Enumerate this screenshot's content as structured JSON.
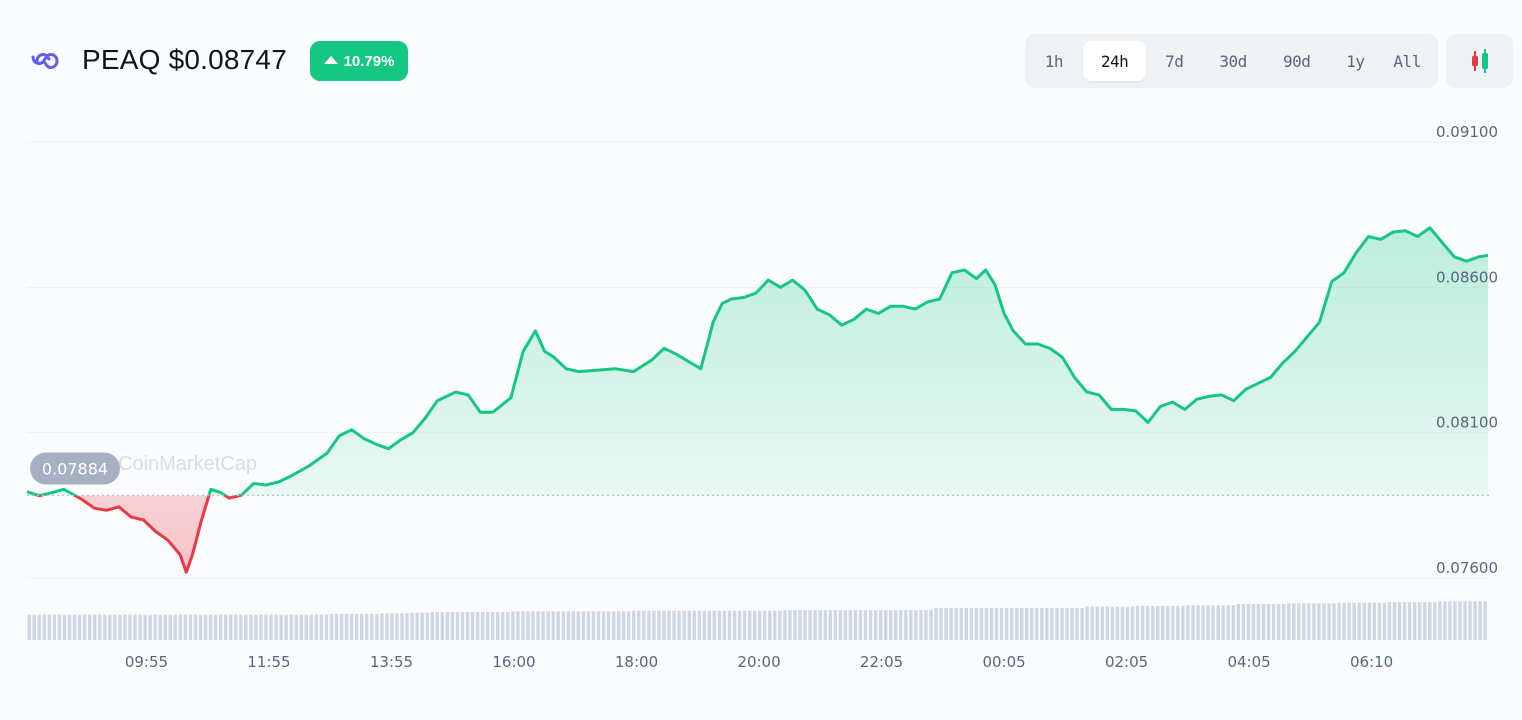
{
  "header": {
    "coin_title": "PEAQ $0.08747",
    "change": "10.79%",
    "logo_icon": "peaq-infinity-icon",
    "candle_icon": "candlestick-icon"
  },
  "tabs": [
    {
      "label": "1h",
      "active": false
    },
    {
      "label": "24h",
      "active": true
    },
    {
      "label": "7d",
      "active": false
    },
    {
      "label": "30d",
      "active": false
    },
    {
      "label": "90d",
      "active": false
    },
    {
      "label": "1y",
      "active": false
    },
    {
      "label": "All",
      "active": false
    }
  ],
  "watermark": "CoinMarketCap",
  "colors": {
    "up": "#16c784",
    "down": "#ea3943",
    "badge": "#16c784",
    "grid": "#eff2f5",
    "volume": "#cfd6e4",
    "ref_label_bg": "#a6b0c3"
  },
  "chart_data": {
    "type": "line",
    "title": "",
    "xlabel": "",
    "ylabel": "",
    "ylim": [
      0.0755,
      0.0915
    ],
    "yticks": [
      0.076,
      0.081,
      0.086,
      0.091
    ],
    "ytick_labels": [
      "0.07600",
      "0.08100",
      "0.08600",
      "0.09100"
    ],
    "reference_price": 0.07884,
    "reference_label": "0.07884",
    "grid": true,
    "xtick_labels": [
      "09:55",
      "11:55",
      "13:55",
      "16:00",
      "18:00",
      "20:00",
      "22:05",
      "00:05",
      "02:05",
      "04:05",
      "06:10"
    ],
    "xtick_positions": [
      1.95,
      3.95,
      5.95,
      7.95,
      9.95,
      11.95,
      13.95,
      15.95,
      17.95,
      19.95,
      21.95
    ],
    "x_hours_from_start": [
      0,
      0.2,
      0.4,
      0.6,
      0.9,
      1.1,
      1.3,
      1.5,
      1.7,
      1.9,
      2.1,
      2.3,
      2.5,
      2.6,
      2.7,
      2.85,
      3.0,
      3.15,
      3.3,
      3.5,
      3.7,
      3.9,
      4.1,
      4.3,
      4.6,
      4.9,
      5.1,
      5.3,
      5.5,
      5.7,
      5.9,
      6.1,
      6.3,
      6.5,
      6.7,
      7.0,
      7.2,
      7.4,
      7.6,
      7.9,
      8.1,
      8.3,
      8.45,
      8.6,
      8.8,
      9.0,
      9.3,
      9.6,
      9.9,
      10.2,
      10.4,
      10.6,
      10.8,
      11.0,
      11.2,
      11.35,
      11.5,
      11.7,
      11.9,
      12.1,
      12.3,
      12.5,
      12.7,
      12.9,
      13.1,
      13.3,
      13.5,
      13.7,
      13.9,
      14.1,
      14.3,
      14.5,
      14.7,
      14.9,
      15.1,
      15.3,
      15.5,
      15.65,
      15.8,
      15.95,
      16.1,
      16.3,
      16.5,
      16.7,
      16.9,
      17.1,
      17.3,
      17.5,
      17.7,
      17.9,
      18.1,
      18.3,
      18.5,
      18.7,
      18.9,
      19.1,
      19.3,
      19.5,
      19.7,
      19.9,
      20.1,
      20.3,
      20.5,
      20.7,
      20.9,
      21.1,
      21.3,
      21.5,
      21.7,
      21.9,
      22.1,
      22.3,
      22.5,
      22.7,
      22.9,
      23.1,
      23.3,
      23.5,
      23.7,
      23.85
    ],
    "series": [
      {
        "values": [
          0.07897,
          0.07883,
          0.07893,
          0.07905,
          0.0787,
          0.0784,
          0.07833,
          0.07845,
          0.0781,
          0.078,
          0.0776,
          0.0773,
          0.0768,
          0.0762,
          0.0768,
          0.078,
          0.07905,
          0.07895,
          0.07875,
          0.07885,
          0.07925,
          0.0792,
          0.0793,
          0.0795,
          0.07985,
          0.0803,
          0.0809,
          0.0811,
          0.0808,
          0.0806,
          0.08045,
          0.08075,
          0.081,
          0.0815,
          0.0821,
          0.0824,
          0.0823,
          0.0817,
          0.0817,
          0.0822,
          0.0838,
          0.0845,
          0.0838,
          0.0836,
          0.0832,
          0.0831,
          0.08315,
          0.0832,
          0.0831,
          0.0835,
          0.0839,
          0.0837,
          0.08345,
          0.0832,
          0.0848,
          0.08545,
          0.0856,
          0.08565,
          0.0858,
          0.08625,
          0.086,
          0.08625,
          0.0859,
          0.08525,
          0.08505,
          0.0847,
          0.0849,
          0.08525,
          0.0851,
          0.08535,
          0.08535,
          0.08525,
          0.0855,
          0.0856,
          0.0865,
          0.0866,
          0.0863,
          0.0866,
          0.0861,
          0.0851,
          0.0845,
          0.08405,
          0.08405,
          0.0839,
          0.0836,
          0.0829,
          0.0824,
          0.0823,
          0.0818,
          0.0818,
          0.08175,
          0.08135,
          0.0819,
          0.08205,
          0.0818,
          0.08215,
          0.08225,
          0.0823,
          0.0821,
          0.0825,
          0.0827,
          0.0829,
          0.0834,
          0.0838,
          0.0843,
          0.0848,
          0.0862,
          0.0865,
          0.0872,
          0.08775,
          0.08765,
          0.0879,
          0.08795,
          0.08775,
          0.08805,
          0.08755,
          0.08705,
          0.0869,
          0.08705,
          0.0871
        ]
      }
    ],
    "volume": [
      38,
      38,
      38,
      38,
      38,
      38,
      38,
      38,
      38,
      38,
      38,
      38,
      38,
      38,
      38,
      38,
      38,
      38,
      38,
      38,
      38,
      38,
      38,
      38,
      38,
      38,
      38,
      38,
      38,
      38,
      38,
      38,
      38,
      38,
      38,
      38,
      38,
      38,
      38,
      38,
      38,
      38,
      38,
      38,
      38,
      38,
      38,
      38,
      38,
      38,
      38,
      38,
      38,
      38,
      38,
      38,
      38,
      38,
      38,
      38,
      39,
      39,
      39,
      39,
      39,
      39,
      39,
      39,
      39,
      39,
      40,
      40,
      40,
      40,
      40,
      40,
      41,
      41,
      41,
      41,
      42,
      42,
      42,
      42,
      42,
      42,
      42,
      42,
      42,
      42,
      42,
      42,
      42,
      42,
      42,
      42,
      43,
      43,
      43,
      43,
      43,
      43,
      43,
      43,
      43,
      43,
      43,
      43,
      43,
      43,
      43,
      43,
      43,
      43,
      43,
      43,
      43,
      43,
      43,
      43,
      44,
      44,
      44,
      44,
      44,
      44,
      44,
      44,
      44,
      44,
      44,
      44,
      44,
      44,
      44,
      44,
      44,
      44,
      44,
      44,
      44,
      44,
      44,
      44,
      44,
      44,
      44,
      44,
      44,
      44,
      45,
      45,
      45,
      45,
      45,
      45,
      45,
      45,
      45,
      45,
      45,
      45,
      45,
      45,
      45,
      45,
      45,
      45,
      45,
      45,
      45,
      45,
      45,
      45,
      45,
      45,
      45,
      45,
      45,
      45,
      48,
      48,
      48,
      48,
      48,
      48,
      48,
      48,
      48,
      48,
      48,
      48,
      48,
      48,
      48,
      48,
      48,
      48,
      48,
      48,
      48,
      48,
      48,
      48,
      48,
      48,
      48,
      48,
      48,
      48,
      50,
      50,
      50,
      50,
      50,
      50,
      50,
      50,
      50,
      50,
      51,
      51,
      51,
      51,
      51,
      51,
      51,
      51,
      51,
      51,
      52,
      52,
      52,
      52,
      52,
      52,
      52,
      52,
      52,
      52,
      54,
      54,
      54,
      54,
      54,
      54,
      54,
      54,
      54,
      54,
      55,
      55,
      55,
      55,
      55,
      55,
      55,
      55,
      55,
      55,
      56,
      56,
      56,
      56,
      56,
      56,
      56,
      56,
      56,
      56,
      57,
      57,
      57,
      57,
      57,
      57,
      57,
      57,
      57,
      57,
      58,
      58,
      58,
      58,
      58,
      58,
      58,
      58,
      58,
      58
    ]
  }
}
